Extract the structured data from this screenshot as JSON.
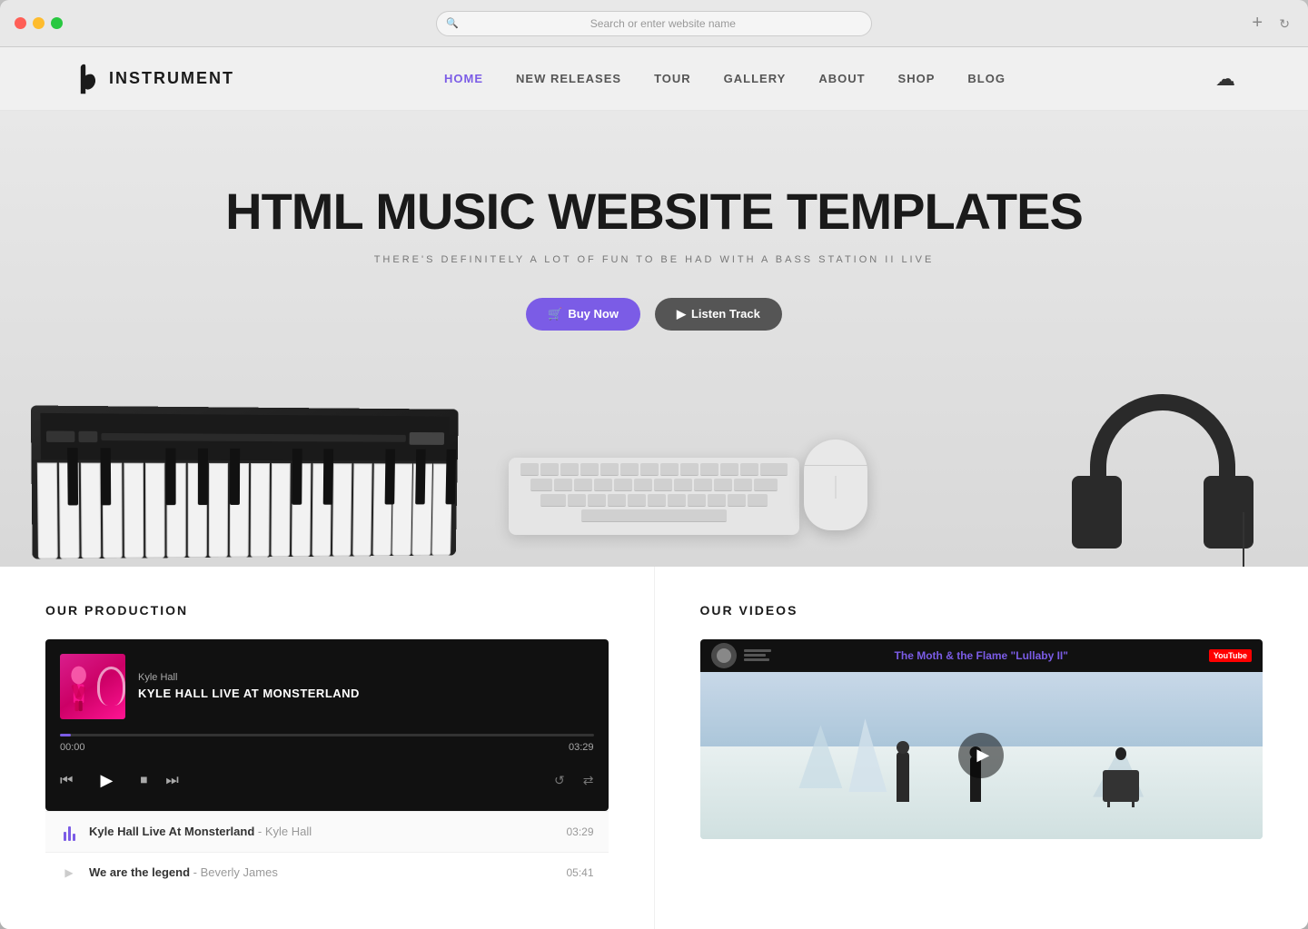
{
  "browser": {
    "address_placeholder": "Search or enter website name"
  },
  "nav": {
    "logo_text": "INSTRUMENT",
    "links": [
      {
        "label": "HOME",
        "active": true
      },
      {
        "label": "NEW RELEASES",
        "active": false
      },
      {
        "label": "TOUR",
        "active": false
      },
      {
        "label": "GALLERY",
        "active": false
      },
      {
        "label": "ABOUT",
        "active": false
      },
      {
        "label": "SHOP",
        "active": false
      },
      {
        "label": "BLOG",
        "active": false
      }
    ]
  },
  "hero": {
    "title": "HTML MUSIC WEBSITE TEMPLATES",
    "subtitle": "THERE'S DEFINITELY A LOT OF FUN TO BE HAD WITH A BASS STATION II LIVE",
    "btn_buy": "Buy Now",
    "btn_listen": "Listen Track"
  },
  "production": {
    "section_title": "OUR PRODUCTION",
    "player": {
      "artist": "Kyle Hall",
      "title": "KYLE HALL LIVE AT MONSTERLAND",
      "current_time": "00:00",
      "total_time": "03:29"
    },
    "tracks": [
      {
        "name": "Kyle Hall Live At Monsterland",
        "artist": "Kyle Hall",
        "duration": "03:29",
        "active": true
      },
      {
        "name": "We are the legend",
        "artist": "Beverly James",
        "duration": "05:41",
        "active": false
      }
    ]
  },
  "videos": {
    "section_title": "OUR VIDEOS",
    "video_title": "The Moth & the Flame \"Lullaby II\""
  }
}
